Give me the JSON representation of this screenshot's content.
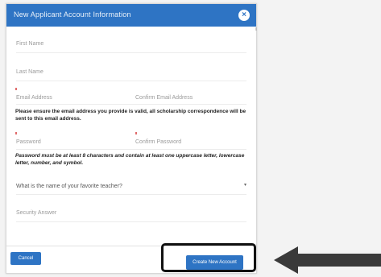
{
  "dialog": {
    "title": "New Applicant Account Information",
    "close_icon": "close-icon"
  },
  "form": {
    "first_name_placeholder": "First Name",
    "last_name_placeholder": "Last Name",
    "email_placeholder": "Email Address",
    "confirm_email_placeholder": "Confirm Email Address",
    "email_note": "Please ensure the email address you provide is valid, all scholarship correspondence will be sent to this email address.",
    "password_placeholder": "Password",
    "confirm_password_placeholder": "Confirm Password",
    "password_note": "Password must be at least 8 characters and contain at least one uppercase letter, lowercase letter, number, and symbol.",
    "security_question_value": "What is the name of your favorite teacher?",
    "security_answer_placeholder": "Security Answer"
  },
  "buttons": {
    "cancel_label": "Cancel",
    "create_label": "Create New Account"
  },
  "colors": {
    "accent": "#2e74c4",
    "required": "#e06b6b"
  }
}
